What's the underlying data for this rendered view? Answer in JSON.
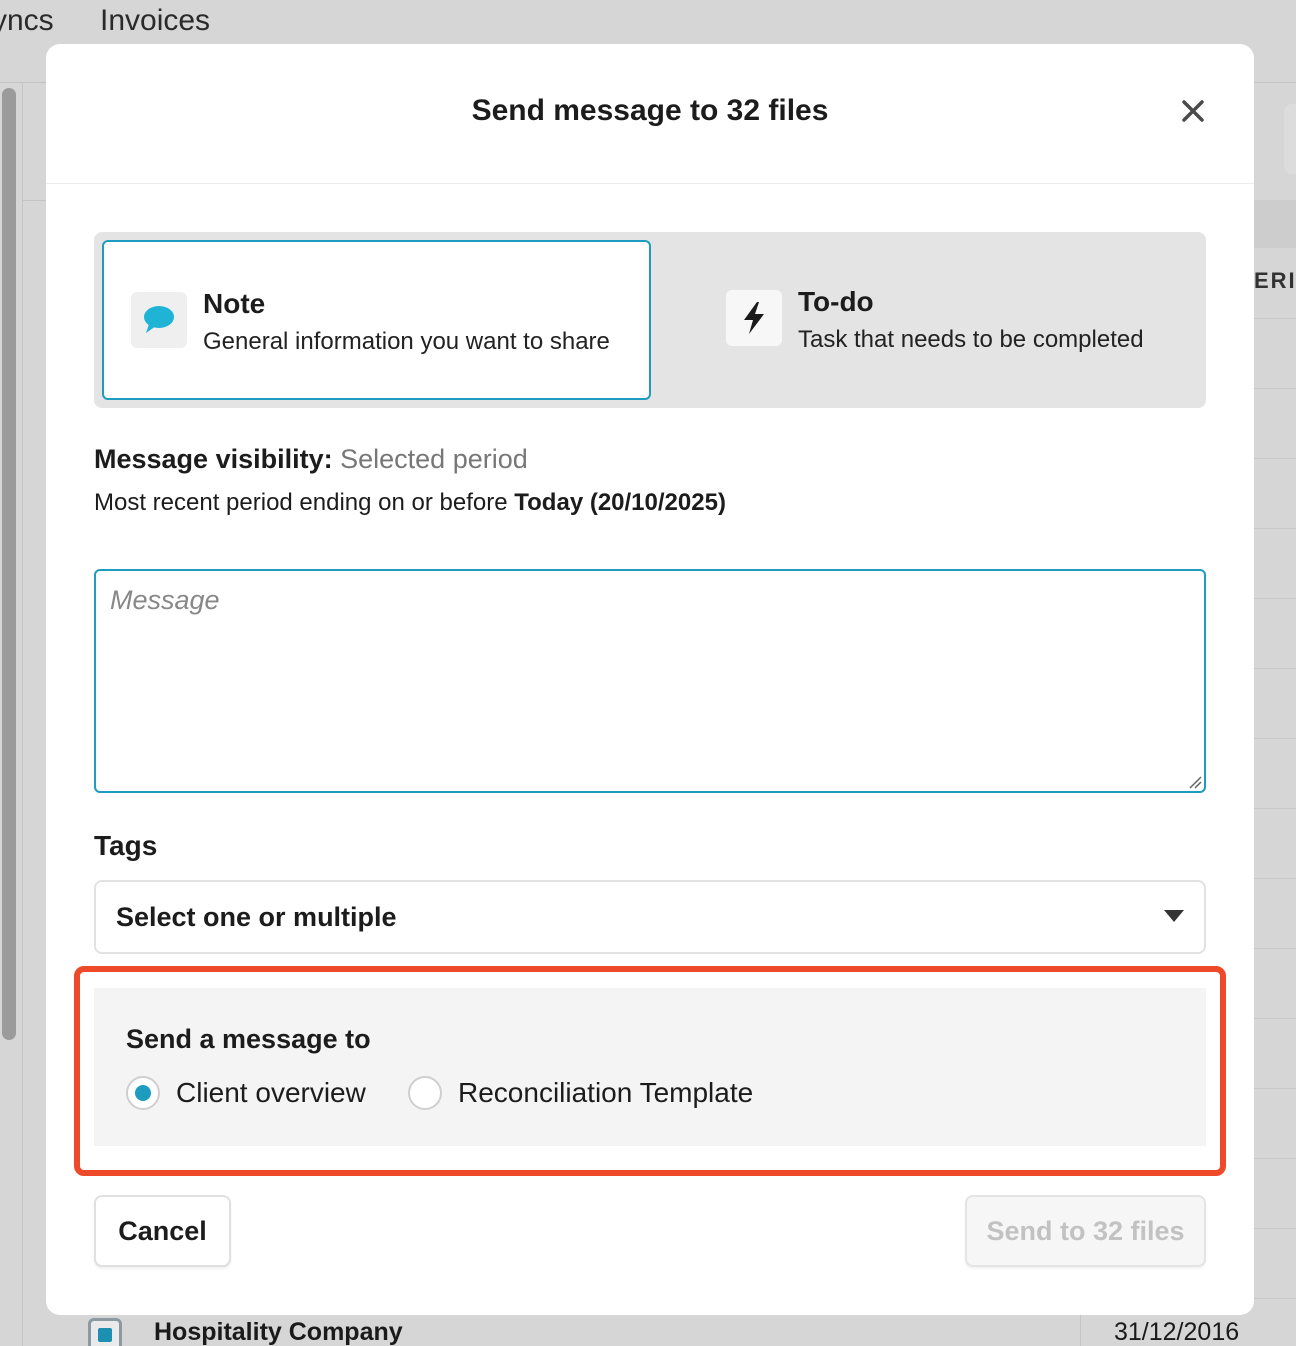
{
  "background": {
    "tabs": [
      "yncs",
      "Invoices"
    ],
    "column_header_partial": "ERI",
    "row": {
      "company": "Hospitality Company",
      "date": "31/12/2016"
    }
  },
  "modal": {
    "title": "Send message to 32 files",
    "close_icon": "close-icon",
    "types": {
      "note": {
        "name": "Note",
        "description": "General information you want to share",
        "icon": "speech-bubble-icon",
        "selected": true
      },
      "todo": {
        "name": "To-do",
        "description": "Task that needs to be completed",
        "icon": "lightning-bolt-icon",
        "selected": false
      }
    },
    "visibility": {
      "label": "Message visibility:",
      "value": "Selected period",
      "period_prefix": "Most recent period ending on or before",
      "period_date": "Today (20/10/2025)"
    },
    "message": {
      "placeholder": "Message",
      "value": ""
    },
    "tags": {
      "label": "Tags",
      "placeholder": "Select one or multiple"
    },
    "send_to": {
      "title": "Send a message to",
      "options": [
        {
          "label": "Client overview",
          "checked": true
        },
        {
          "label": "Reconciliation Template",
          "checked": false
        }
      ]
    },
    "buttons": {
      "cancel": "Cancel",
      "submit": "Send to 32 files",
      "submit_disabled": true
    }
  },
  "colors": {
    "accent": "#1d9cc0",
    "highlight": "#ee4a2a",
    "overlay": "#d6d6d6"
  }
}
